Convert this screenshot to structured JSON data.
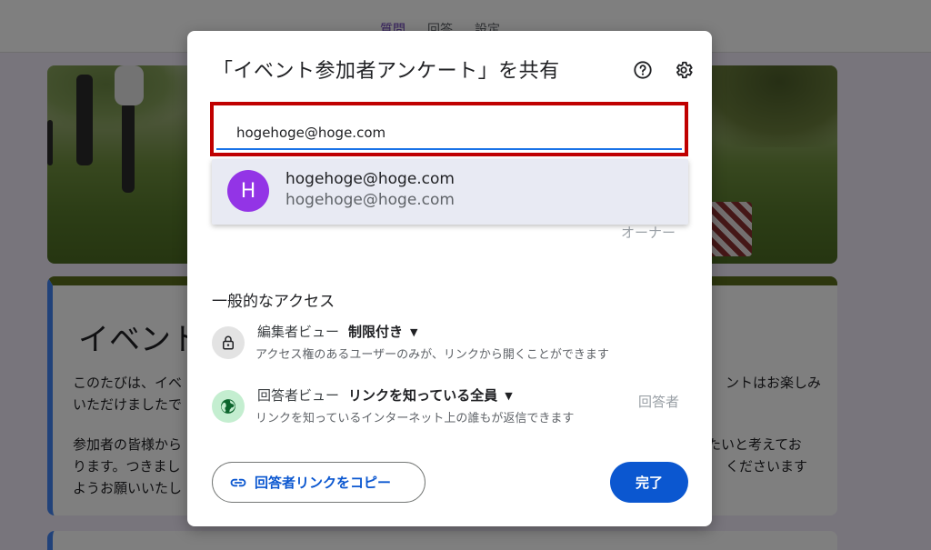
{
  "background": {
    "tabs": [
      "質問",
      "回答",
      "設定"
    ],
    "card_title": "イベント",
    "text_left_1": "このたびは、イベ",
    "text_left_2": "いただけましたで",
    "text_right_1": "ントはお楽しみ",
    "text_left_3": "参加者の皆様から",
    "text_left_4": "ります。つきまし",
    "text_left_5": "ようお願いいたし",
    "text_right_3": "たいと考えてお",
    "text_right_4": "ください​ます"
  },
  "dialog": {
    "title": "「イベント参加者アンケート」を共有",
    "email_input": {
      "value": "hogehoge@hoge.com"
    },
    "suggestion": {
      "avatar_letter": "H",
      "name": "hogehoge@hoge.com",
      "email": "hogehoge@hoge.com"
    },
    "owner_label": "オーナー",
    "general_access": {
      "title": "一般的なアクセス",
      "rows": [
        {
          "label": "編集者ビュー",
          "value": "制限付き",
          "description": "アクセス権のあるユーザーのみが、リンクから開くことができます",
          "role": ""
        },
        {
          "label": "回答者ビュー",
          "value": "リンクを知っている全員",
          "description": "リンクを知っているインターネット上の誰もが返信できます",
          "role": "回答者"
        }
      ]
    },
    "copy_link_button": "回答者リンクをコピー",
    "done_button": "完了"
  },
  "colors": {
    "highlight_border": "#c00000",
    "avatar": "#9334e6",
    "primary": "#0b57d0",
    "globe_bg": "#c4eed0",
    "lock_bg": "#e3e3e3"
  }
}
